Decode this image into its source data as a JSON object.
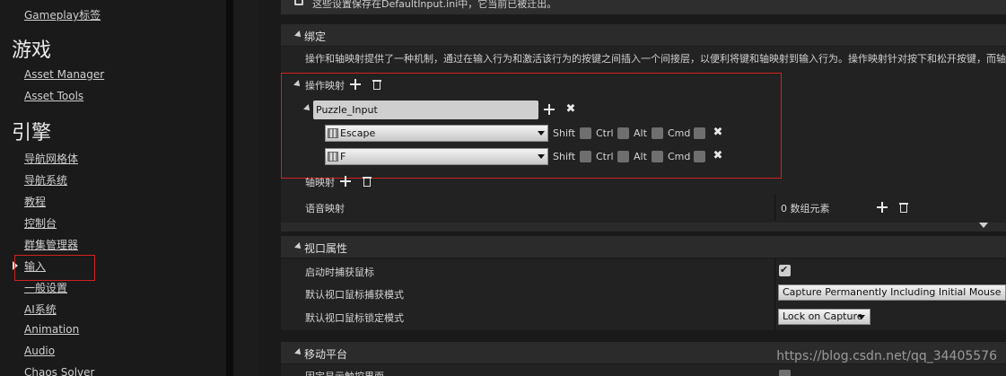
{
  "sidebar": {
    "items": [
      {
        "label": "Gameplay标签"
      },
      {
        "label": "Asset Manager"
      },
      {
        "label": "Asset Tools"
      },
      {
        "label": "导航网格体"
      },
      {
        "label": "导航系统"
      },
      {
        "label": "教程"
      },
      {
        "label": "控制台"
      },
      {
        "label": "群集管理器"
      },
      {
        "label": "输入"
      },
      {
        "label": "一般设置"
      },
      {
        "label": "AI系统"
      },
      {
        "label": "Animation"
      },
      {
        "label": "Audio"
      },
      {
        "label": "Chaos Solver"
      }
    ],
    "categories": [
      {
        "label": "游戏"
      },
      {
        "label": "引擎"
      }
    ],
    "selected": "输入"
  },
  "main": {
    "notice": "这些设置保存在DefaultInput.ini中，它当前已被迁出。",
    "bindings": {
      "header": "绑定",
      "description": "操作和轴映射提供了一种机制，通过在输入行为和激活该行为的按键之间插入一个间接层，以便利将键和轴映射到输入行为。操作映射针对按下和松开按键，而轴",
      "action_mappings_label": "操作映射",
      "action_name": "Puzzle_Input",
      "keys": [
        {
          "key": "Escape",
          "shift": "Shift",
          "ctrl": "Ctrl",
          "alt": "Alt",
          "cmd": "Cmd"
        },
        {
          "key": "F",
          "shift": "Shift",
          "ctrl": "Ctrl",
          "alt": "Alt",
          "cmd": "Cmd"
        }
      ],
      "axis_mappings_label": "轴映射",
      "speech_mappings_label": "语音映射",
      "speech_mappings_value": "0 数组元素"
    },
    "viewport": {
      "header": "视口属性",
      "rows": [
        {
          "label": "启动时捕获鼠标"
        },
        {
          "label": "默认视口鼠标捕获模式",
          "value": "Capture Permanently Including Initial Mouse Down"
        },
        {
          "label": "默认视口鼠标锁定模式",
          "value": "Lock on Capture"
        }
      ]
    },
    "mobile": {
      "header": "移动平台",
      "rows": [
        {
          "label": "固定显示触控界面"
        }
      ]
    }
  },
  "watermark": "https://blog.csdn.net/qq_34405576",
  "colors": {
    "highlight_border": "#d42020",
    "panel_bg": "#1a1a1a",
    "row_bg": "#242424"
  }
}
